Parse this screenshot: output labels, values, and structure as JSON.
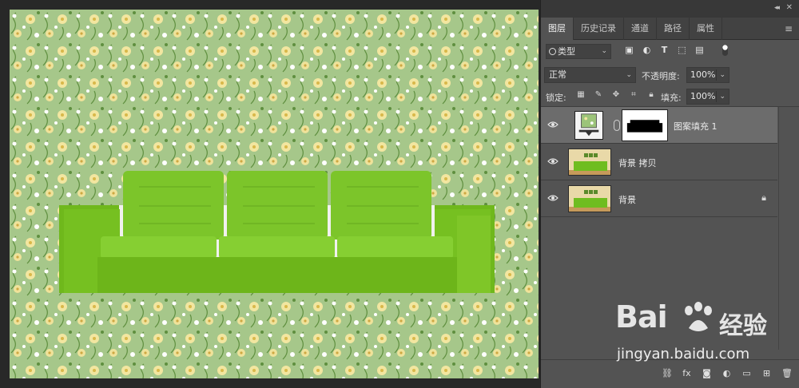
{
  "panel": {
    "tabs": [
      {
        "label": "图层",
        "active": true
      },
      {
        "label": "历史记录"
      },
      {
        "label": "通道"
      },
      {
        "label": "路径"
      },
      {
        "label": "属性"
      }
    ],
    "filter": {
      "kind_label": "类型"
    },
    "blend_mode": "正常",
    "opacity_label": "不透明度:",
    "opacity_value": "100%",
    "lock_label": "锁定:",
    "fill_label": "填充:",
    "fill_value": "100%"
  },
  "layers": [
    {
      "name": "图案填充 1",
      "selected": true,
      "type": "pattern-fill"
    },
    {
      "name": "背景 拷贝",
      "selected": false,
      "type": "image"
    },
    {
      "name": "背景",
      "selected": false,
      "type": "image",
      "locked": true
    }
  ],
  "watermark": {
    "logo": "Bai",
    "logo_suffix": "经验",
    "url": "jingyan.baidu.com"
  },
  "colors": {
    "panel_bg": "#535353",
    "canvas_bg": "#282828",
    "pattern_base": "#a9c98c",
    "sofa_green": "#7dc424"
  }
}
